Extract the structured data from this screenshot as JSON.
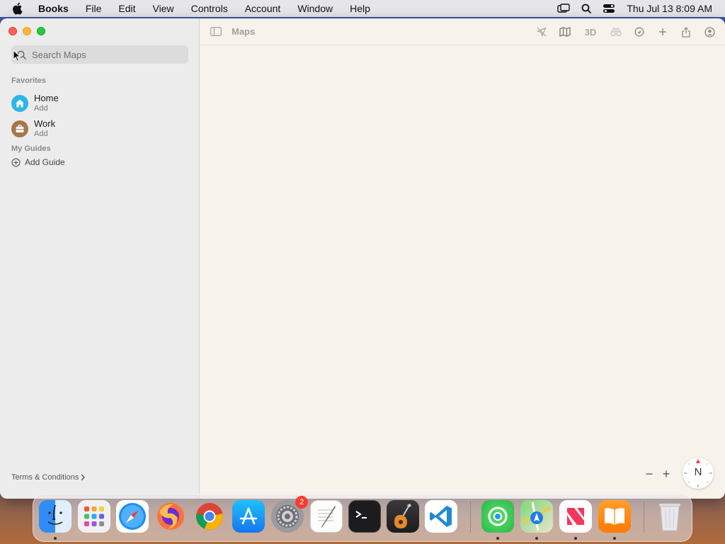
{
  "menubar": {
    "app_name": "Books",
    "items": [
      "File",
      "Edit",
      "View",
      "Controls",
      "Account",
      "Window",
      "Help"
    ],
    "clock": "Thu Jul 13  8:09 AM"
  },
  "window": {
    "title": "Maps",
    "search": {
      "placeholder": "Search Maps"
    },
    "favorites_label": "Favorites",
    "favorites": [
      {
        "name": "Home",
        "sub": "Add",
        "color": "#2cb6e8"
      },
      {
        "name": "Work",
        "sub": "Add",
        "color": "#a5774a"
      }
    ],
    "guides_label": "My Guides",
    "add_guide": "Add Guide",
    "terms": "Terms & Conditions",
    "toolbar": {
      "three_d": "3D"
    },
    "compass": "N",
    "zoom_out": "−",
    "zoom_in": "+"
  },
  "dock": {
    "settings_badge": "2"
  }
}
